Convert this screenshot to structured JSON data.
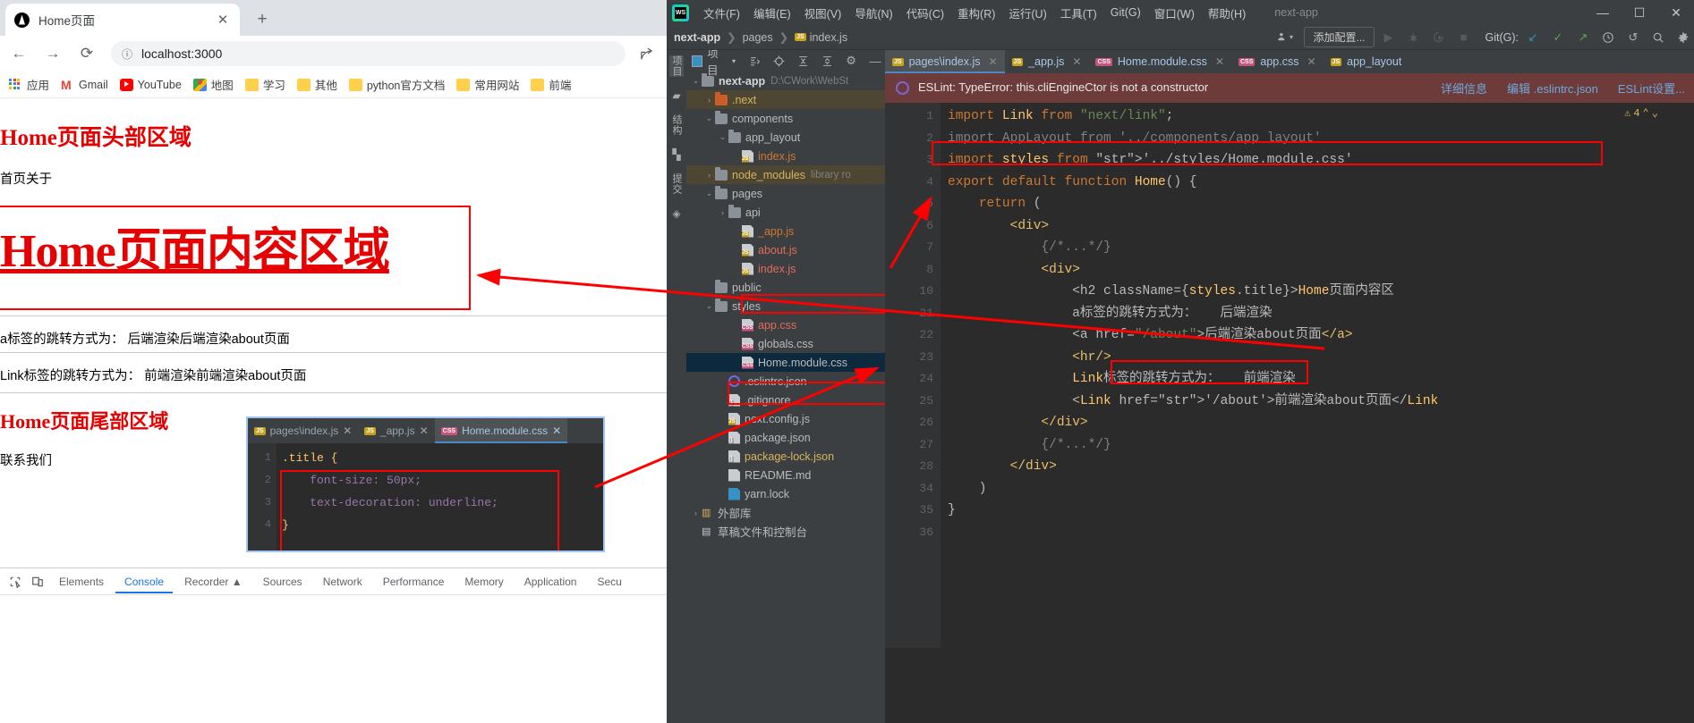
{
  "browser": {
    "tab": {
      "title": "Home页面",
      "close": "✕"
    },
    "new_tab": "+",
    "nav": {
      "back": "←",
      "forward": "→",
      "reload": "⟳",
      "info": "ⓘ",
      "url": "localhost:3000"
    },
    "bookmarks": [
      {
        "label": "应用",
        "icon": "apps-grid-icon"
      },
      {
        "label": "Gmail",
        "icon": "gmail-icon"
      },
      {
        "label": "YouTube",
        "icon": "youtube-icon"
      },
      {
        "label": "地图",
        "icon": "maps-icon"
      },
      {
        "label": "学习",
        "icon": "folder-icon"
      },
      {
        "label": "其他",
        "icon": "folder-icon"
      },
      {
        "label": "python官方文档",
        "icon": "folder-icon"
      },
      {
        "label": "常用网站",
        "icon": "folder-icon"
      },
      {
        "label": "前端",
        "icon": "folder-icon"
      }
    ]
  },
  "page": {
    "head_title": "Home页面头部区域",
    "nav_links": [
      "首页",
      "关于"
    ],
    "content_title": "Home页面内容区域",
    "line_a": "a标签的跳转方式为：  后端渲染后端渲染about页面",
    "line_b": "Link标签的跳转方式为：  前端渲染前端渲染about页面",
    "foot_title": "Home页面尾部区域",
    "contact": "联系我们"
  },
  "css_overlay": {
    "tabs": [
      {
        "label": "pages\\index.js",
        "type": "js",
        "active": false
      },
      {
        "label": "_app.js",
        "type": "js",
        "active": false
      },
      {
        "label": "Home.module.css",
        "type": "css",
        "active": true
      }
    ],
    "line_numbers": [
      "1",
      "2",
      "3",
      "4"
    ],
    "code": [
      ".title {",
      "    font-size: 50px;",
      "    text-decoration: underline;",
      "}"
    ]
  },
  "devtools": {
    "tabs": [
      "Elements",
      "Console",
      "Recorder",
      "Sources",
      "Network",
      "Performance",
      "Memory",
      "Application",
      "Secu"
    ],
    "active_tab": "Console",
    "recorder_badge": "▲"
  },
  "ide": {
    "menu": [
      "文件(F)",
      "编辑(E)",
      "视图(V)",
      "导航(N)",
      "代码(C)",
      "重构(R)",
      "运行(U)",
      "工具(T)",
      "Git(G)",
      "窗口(W)",
      "帮助(H)"
    ],
    "project_name": "next-app",
    "window_controls": [
      "—",
      "☐",
      "✕"
    ],
    "breadcrumb": [
      "next-app",
      "pages",
      "index.js"
    ],
    "run_config": "添加配置...",
    "git_label": "Git(G):",
    "toolwindow_labels": [
      "项目",
      "结构",
      "提交"
    ],
    "project_header": "项目",
    "tree": [
      {
        "depth": 0,
        "chev": "⌄",
        "icon": "folder-icon",
        "label": "next-app",
        "sub": "D:\\CWork\\WebSt",
        "bold": true,
        "color": "white"
      },
      {
        "depth": 1,
        "chev": "›",
        "icon": "folder-orange-icon",
        "label": ".next",
        "color": "yellow",
        "hl": "brown"
      },
      {
        "depth": 1,
        "chev": "⌄",
        "icon": "folder-icon",
        "label": "components",
        "color": "normal"
      },
      {
        "depth": 2,
        "chev": "⌄",
        "icon": "folder-icon",
        "label": "app_layout",
        "color": "normal"
      },
      {
        "depth": 3,
        "chev": "",
        "icon": "js-file-icon",
        "label": "index.js",
        "color": "orange"
      },
      {
        "depth": 1,
        "chev": "›",
        "icon": "folder-icon",
        "label": "node_modules",
        "sub": "library ro",
        "color": "yellow",
        "hl": "brown"
      },
      {
        "depth": 1,
        "chev": "⌄",
        "icon": "folder-icon",
        "label": "pages",
        "color": "normal"
      },
      {
        "depth": 2,
        "chev": "›",
        "icon": "folder-icon",
        "label": "api",
        "color": "normal"
      },
      {
        "depth": 3,
        "chev": "",
        "icon": "js-file-icon",
        "label": "_app.js",
        "color": "orange"
      },
      {
        "depth": 3,
        "chev": "",
        "icon": "js-file-icon",
        "label": "about.js",
        "color": "red"
      },
      {
        "depth": 3,
        "chev": "",
        "icon": "js-file-icon",
        "label": "index.js",
        "color": "red",
        "boxed": true
      },
      {
        "depth": 1,
        "chev": "",
        "icon": "folder-icon",
        "label": "public",
        "color": "normal"
      },
      {
        "depth": 1,
        "chev": "⌄",
        "icon": "folder-icon",
        "label": "styles",
        "color": "normal"
      },
      {
        "depth": 3,
        "chev": "",
        "icon": "css-file-icon",
        "label": "app.css",
        "color": "red"
      },
      {
        "depth": 3,
        "chev": "",
        "icon": "css-file-icon",
        "label": "globals.css",
        "color": "normal"
      },
      {
        "depth": 3,
        "chev": "",
        "icon": "css-file-icon",
        "label": "Home.module.css",
        "color": "normal",
        "sel": true,
        "boxed": true
      },
      {
        "depth": 2,
        "chev": "",
        "icon": "eslint-icon",
        "label": ".eslintrc.json",
        "color": "normal"
      },
      {
        "depth": 2,
        "chev": "",
        "icon": "json-file-icon",
        "label": ".gitignore",
        "color": "normal"
      },
      {
        "depth": 2,
        "chev": "",
        "icon": "js-file-icon",
        "label": "next.config.js",
        "color": "normal"
      },
      {
        "depth": 2,
        "chev": "",
        "icon": "json-file-icon",
        "label": "package.json",
        "color": "normal"
      },
      {
        "depth": 2,
        "chev": "",
        "icon": "lock-file-icon",
        "label": "package-lock.json",
        "color": "yellow"
      },
      {
        "depth": 2,
        "chev": "",
        "icon": "md-file-icon",
        "label": "README.md",
        "color": "normal"
      },
      {
        "depth": 2,
        "chev": "",
        "icon": "yarn-file-icon",
        "label": "yarn.lock",
        "color": "normal"
      },
      {
        "depth": 0,
        "chev": "›",
        "icon": "library-icon",
        "label": "外部库",
        "color": "normal"
      },
      {
        "depth": 0,
        "chev": "",
        "icon": "scratch-icon",
        "label": "草稿文件和控制台",
        "color": "normal"
      }
    ],
    "editor_tabs": [
      {
        "label": "pages\\index.js",
        "type": "js",
        "active": true
      },
      {
        "label": "_app.js",
        "type": "js",
        "active": false
      },
      {
        "label": "Home.module.css",
        "type": "css",
        "active": false
      },
      {
        "label": "app.css",
        "type": "css",
        "active": false
      },
      {
        "label": "app_layout",
        "type": "js",
        "active": false
      }
    ],
    "eslint": {
      "message": "ESLint: TypeError: this.cliEngineCtor is not a constructor",
      "links": [
        "详细信息",
        "编辑 .eslintrc.json",
        "ESLint设置..."
      ]
    },
    "warning_badge": "4",
    "line_numbers": [
      "1",
      "2",
      "3",
      "4",
      "5",
      "6",
      "7",
      "8",
      "10",
      "21",
      "22",
      "23",
      "24",
      "25",
      "26",
      "27",
      "28",
      "34",
      "35",
      "36"
    ],
    "code_lines": [
      "import Link from \"next/link\";",
      "import AppLayout from '../components/app_layout'",
      "import styles from '../styles/Home.module.css'",
      "",
      "export default function Home() {",
      "    return (",
      "        <div>",
      "            {/*...*/}",
      "            <div>",
      "                <h2 className={styles.title}>Home页面内容区",
      "                a标签的跳转方式为：   后端渲染",
      "                <a href=\"/about\">后端渲染about页面</a>",
      "                <hr/>",
      "                Link标签的跳转方式为：   前端渲染",
      "                <Link href='/about'>前端渲染about页面</Link",
      "            </div>",
      "            {/*...*/}",
      "        </div>",
      "    )",
      "}"
    ]
  }
}
